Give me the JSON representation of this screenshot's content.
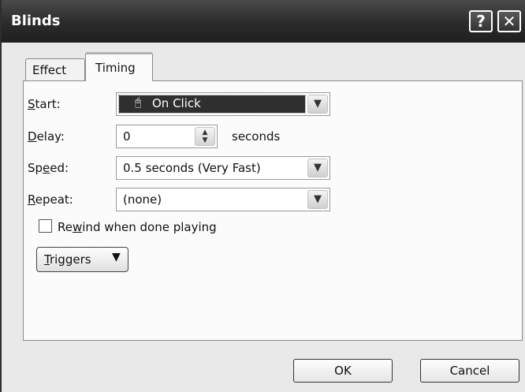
{
  "window": {
    "title": "Blinds",
    "help_glyph": "?",
    "close_glyph": "✕"
  },
  "tabs": [
    {
      "label": "Effect",
      "active": false
    },
    {
      "label": "Timing",
      "active": true
    }
  ],
  "form": {
    "start": {
      "label": "Start:",
      "value": "On Click",
      "icon": "mouse-icon"
    },
    "delay": {
      "label": "Delay:",
      "value": "0",
      "unit": "seconds"
    },
    "speed": {
      "label": "Speed:",
      "value": "0.5 seconds (Very Fast)"
    },
    "repeat": {
      "label": "Repeat:",
      "value": "(none)"
    },
    "rewind": {
      "label": "Rewind when done playing",
      "checked": false
    },
    "triggers_label": "Triggers"
  },
  "buttons": {
    "ok": "OK",
    "cancel": "Cancel"
  }
}
